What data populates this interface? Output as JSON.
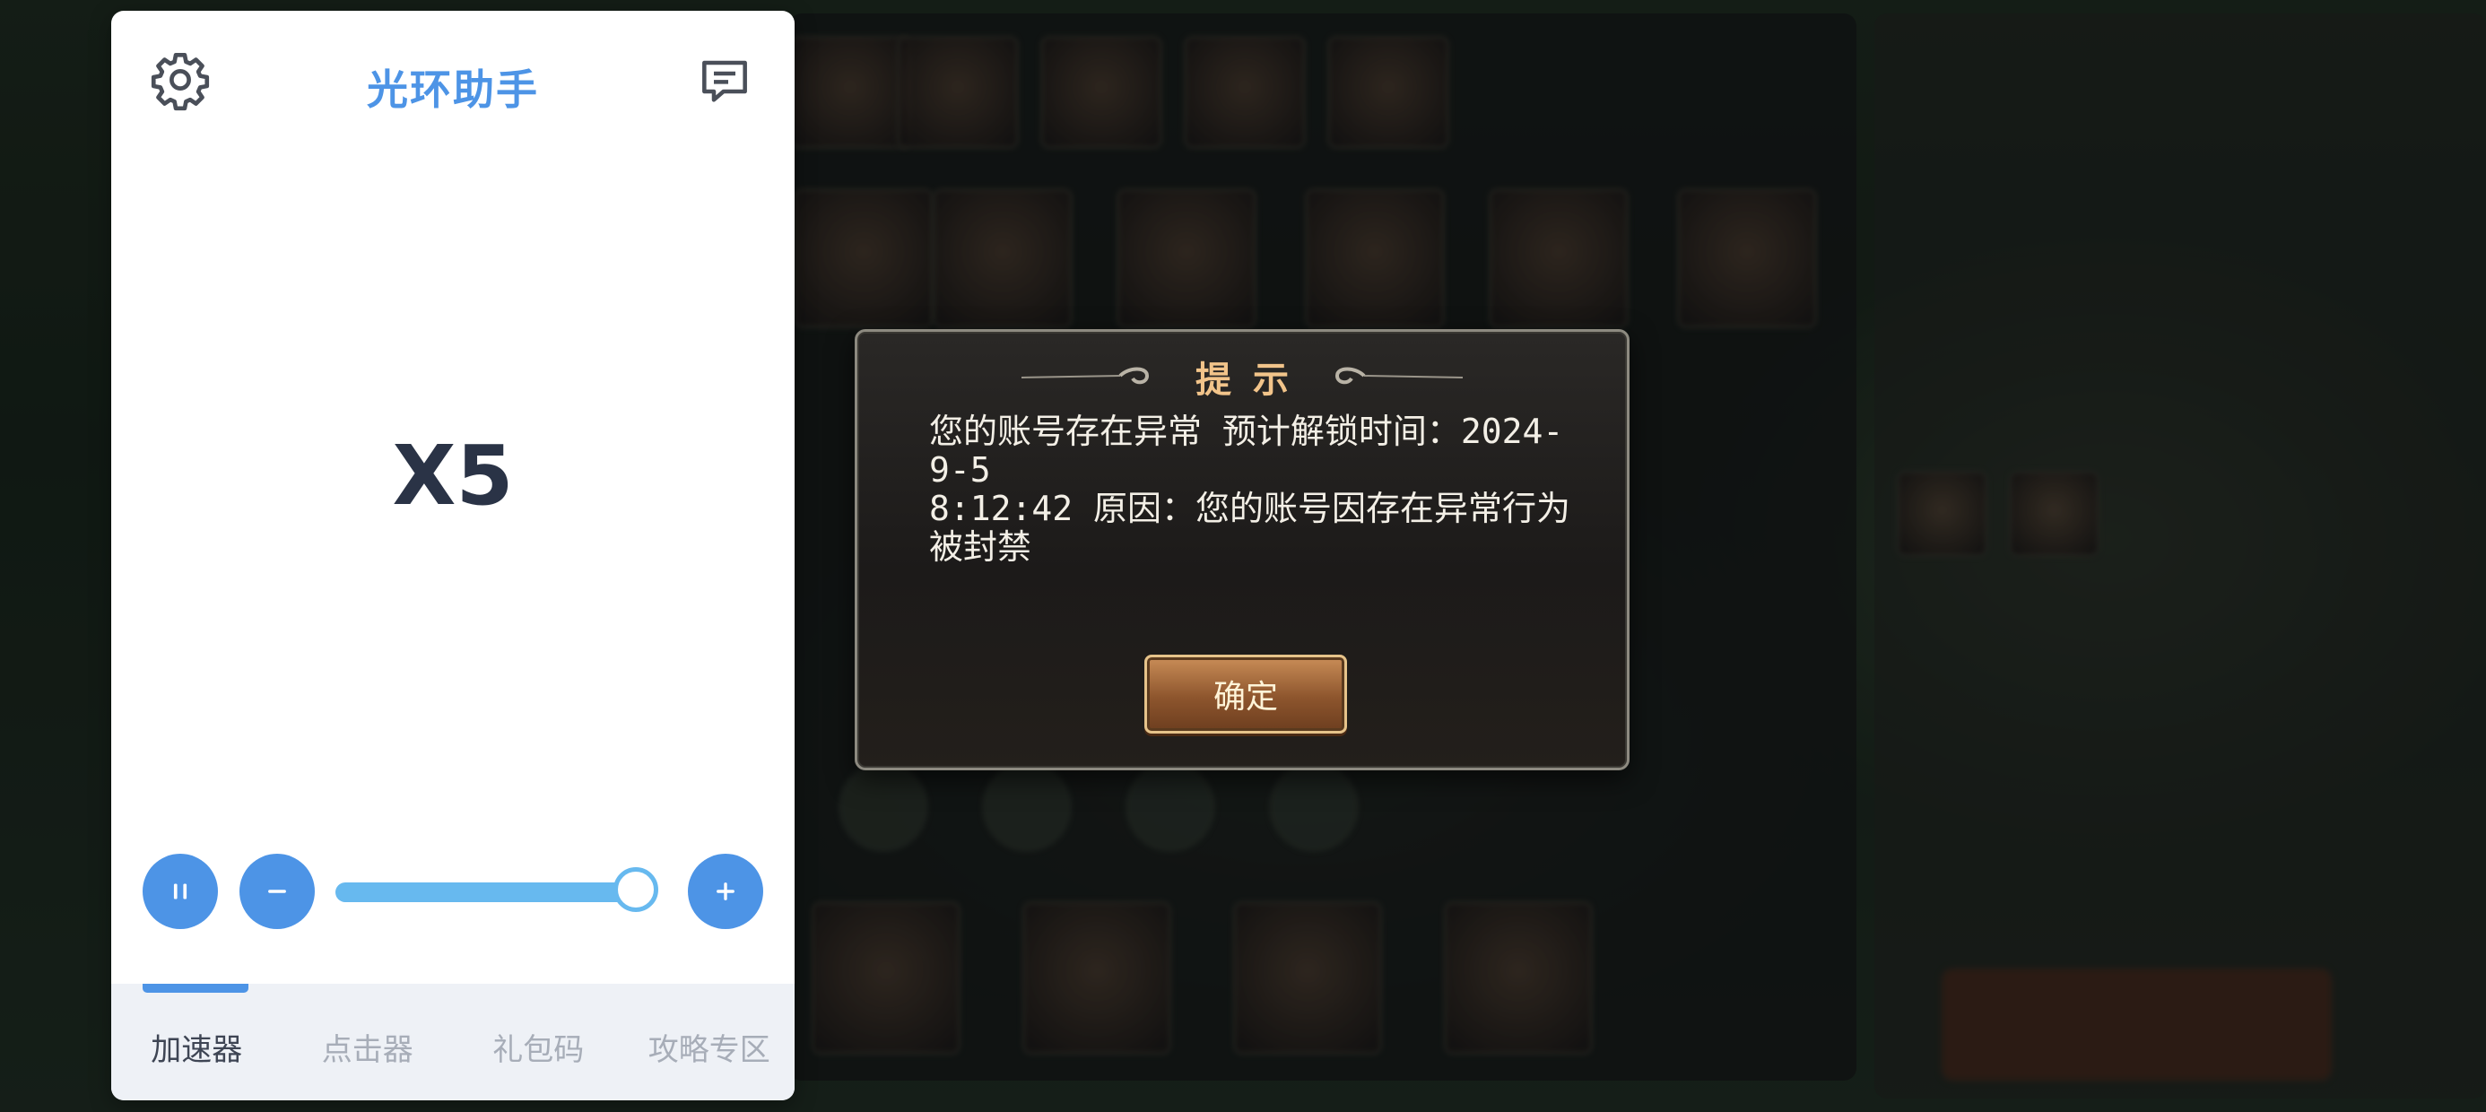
{
  "assistant": {
    "title": "光环助手",
    "speed_multiplier": "X5",
    "speed_level": 1.0,
    "tabs": [
      {
        "label": "加速器",
        "active": true
      },
      {
        "label": "点击器",
        "active": false
      },
      {
        "label": "礼包码",
        "active": false
      },
      {
        "label": "攻略专区",
        "active": false
      }
    ],
    "icons": {
      "settings": "gear-icon",
      "chat": "chat-bubble-icon",
      "pause": "pause-icon",
      "minus": "minus-icon",
      "plus": "plus-icon"
    },
    "colors": {
      "accent": "#4d94e6",
      "slider": "#67b9ef",
      "panel_bg": "#ffffff"
    }
  },
  "game_dialog": {
    "title": "提示",
    "message": "您的账号存在异常 预计解锁时间：2024-9-5\n8:12:42 原因：您的账号因存在异常行为被封禁",
    "confirm_label": "确定",
    "colors": {
      "title": "#f2c48a",
      "button": "#a86a3b"
    }
  }
}
